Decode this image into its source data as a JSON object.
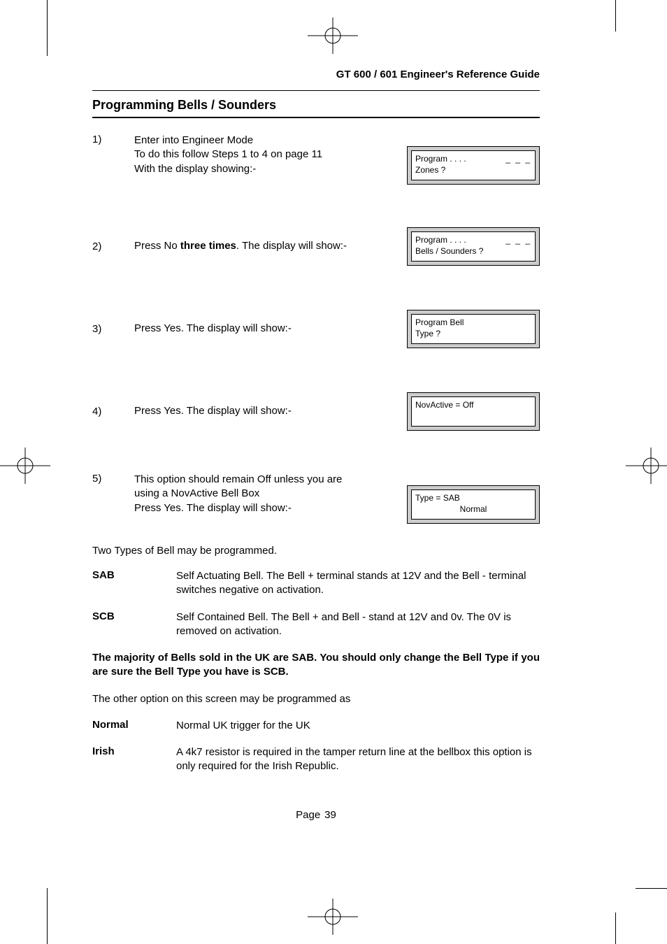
{
  "header": "GT 600 / 601 Engineer's Reference Guide",
  "section_title": "Programming Bells / Sounders",
  "steps": {
    "s1": {
      "num": "1)",
      "l1": "Enter into Engineer Mode",
      "l2": "To do this follow Steps 1 to 4 on page 11",
      "l3": "With the display showing:-",
      "lcd_l1_left": "Program . . . .",
      "lcd_l1_right": "_ _ _",
      "lcd_l2": "Zones ?"
    },
    "s2": {
      "num": "2)",
      "t_pre": "Press No ",
      "t_bold": "three times",
      "t_post": ". The display will show:-",
      "lcd_l1_left": "Program . . . .",
      "lcd_l1_right": "_ _ _",
      "lcd_l2": "Bells / Sounders ?"
    },
    "s3": {
      "num": "3)",
      "text": "Press Yes. The display will show:-",
      "lcd_l1": "Program Bell",
      "lcd_l2": "Type ?"
    },
    "s4": {
      "num": "4)",
      "text": "Press Yes. The display will show:-",
      "lcd_l1": "NovActive = Off",
      "lcd_l2": ""
    },
    "s5": {
      "num": "5)",
      "l1": "This option should remain Off unless you are",
      "l2": "using a NovActive Bell Box",
      "l3": "Press Yes. The display will show:-",
      "lcd_l1": "Type = SAB",
      "lcd_l2": "Normal"
    }
  },
  "intro": "Two Types of Bell may be programmed.",
  "defs": {
    "sab": {
      "term": "SAB",
      "desc": "Self Actuating Bell. The Bell + terminal stands at 12V and the Bell - terminal switches negative on activation."
    },
    "scb": {
      "term": "SCB",
      "desc": "Self Contained Bell. The Bell + and Bell - stand at 12V and 0v. The 0V is removed on activation."
    }
  },
  "bold_note": "The majority of Bells sold in the UK are SAB. You should only change the Bell Type if you are sure the Bell Type you have is SCB.",
  "other_intro": "The other option on this screen may be programmed as",
  "defs2": {
    "normal": {
      "term": "Normal",
      "desc": "Normal UK trigger for the UK"
    },
    "irish": {
      "term": "Irish",
      "desc": "A 4k7 resistor is required in the tamper return line at the bellbox this option is only required for the Irish Republic."
    }
  },
  "footer_label": "Page",
  "footer_num": "39"
}
